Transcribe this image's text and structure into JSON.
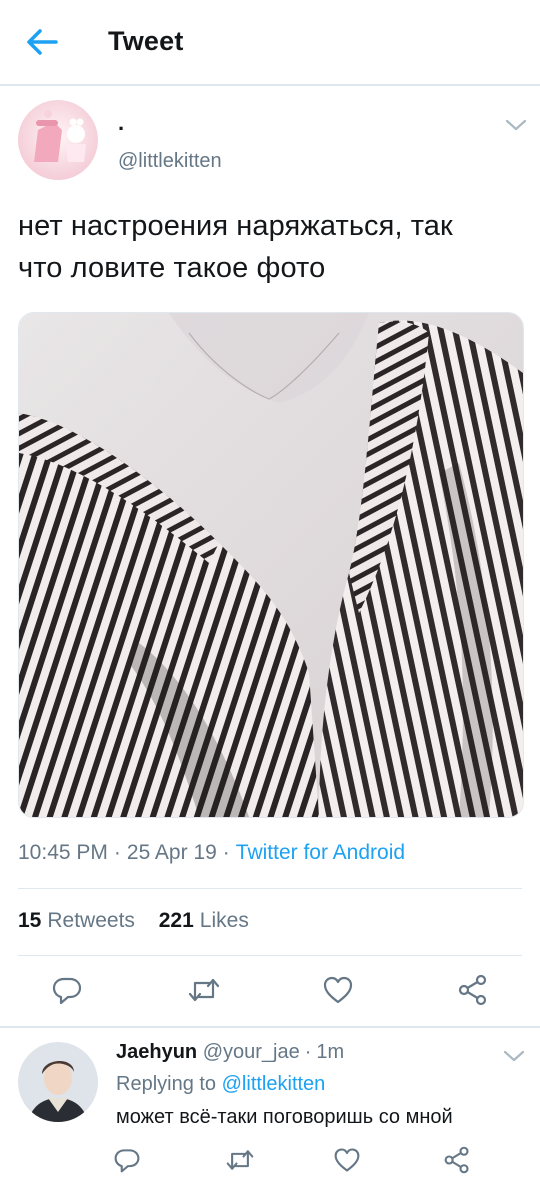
{
  "header": {
    "title": "Tweet",
    "back_icon": "arrow-left-icon"
  },
  "tweet": {
    "display_name": ".",
    "handle": "@littlekitten",
    "text_line1": "нет настроения наряжаться, так",
    "text_line2": "что ловите такое фото",
    "time": "10:45 PM",
    "date": "25 Apr 19",
    "source": "Twitter for Android",
    "retweets_count": "15",
    "retweets_label": "Retweets",
    "likes_count": "221",
    "likes_label": "Likes",
    "separator": "·"
  },
  "actions": [
    "reply-icon",
    "retweet-icon",
    "like-icon",
    "share-icon"
  ],
  "reply": {
    "display_name": "Jaehyun",
    "handle": "@your_jae",
    "time": "1m",
    "replying_prefix": "Replying to",
    "replying_to": "@littlekitten",
    "text": "может всё-таки поговоришь со мной"
  },
  "colors": {
    "accent": "#1da1f2",
    "secondary_text": "#657786",
    "divider": "#e1e8ed"
  }
}
